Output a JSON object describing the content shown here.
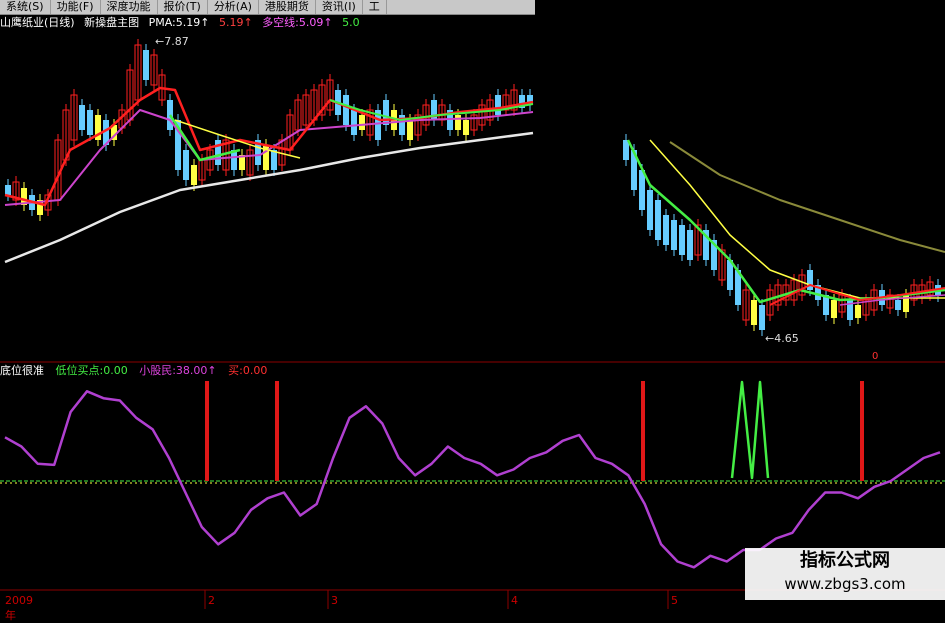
{
  "menu": [
    "系统(S)",
    "功能(F)",
    "深度功能",
    "报价(T)",
    "分析(A)",
    "港股期货",
    "资讯(I)",
    "工"
  ],
  "main_header": {
    "stock": "山鹰纸业(日线)",
    "template": "新操盘主图",
    "pma": "PMA:5.19↑",
    "pma2": "5.19↑",
    "duokong": "多空线:5.09↑",
    "tail": "5.0"
  },
  "sub_header": {
    "name": "底位很准",
    "buy_point": "低位买点:0.00",
    "small_shareholder": "小股民:38.00↑",
    "buy": "买:0.00"
  },
  "annotations": {
    "high": "7.87",
    "low": "←4.65",
    "zero_marker": "0"
  },
  "x_labels": [
    "2009年",
    "2",
    "3",
    "4",
    "5"
  ],
  "watermark": {
    "title": "指标公式网",
    "url": "www.zbgs3.com"
  },
  "colors": {
    "red": "#ff2020",
    "cyan": "#66ccff",
    "yellow": "#ffff44",
    "green": "#44ee44",
    "magenta": "#cc44cc",
    "white": "#e8e8e8",
    "olive": "#8a8a3a",
    "purple": "#b040d0",
    "frame": "#8b0000"
  },
  "chart_data": {
    "type": "line",
    "subchart": {
      "series": [
        {
          "name": "小股民",
          "values": [
            38,
            30,
            15,
            14,
            60,
            78,
            72,
            70,
            55,
            45,
            20,
            -10,
            -40,
            -55,
            -45,
            -25,
            -15,
            -10,
            -30,
            -20,
            20,
            55,
            65,
            50,
            20,
            5,
            15,
            30,
            20,
            15,
            5,
            10,
            20,
            25,
            35,
            40,
            20,
            15,
            5,
            -20,
            -55,
            -70,
            -75,
            -65,
            -70,
            -60,
            -60,
            -50,
            -45,
            -25,
            -10,
            -10,
            -15,
            -5,
            0,
            10,
            20,
            25
          ]
        }
      ]
    }
  }
}
